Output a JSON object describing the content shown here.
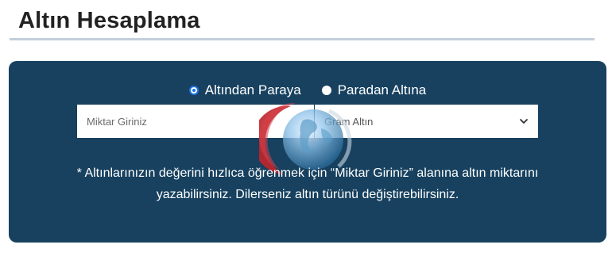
{
  "page": {
    "title": "Altın Hesaplama"
  },
  "calculator": {
    "mode_options": [
      {
        "label": "Altından Paraya",
        "selected": true
      },
      {
        "label": "Paradan Altına",
        "selected": false
      }
    ],
    "amount_input": {
      "placeholder": "Miktar Giriniz",
      "value": ""
    },
    "gold_type_select": {
      "selected": "Gram Altın"
    },
    "info_line_1": "* Altınlarınızın değerini hızlıca öğrenmek için “Miktar Giriniz” alanına altın miktarını",
    "info_line_2": "yazabilirsiniz. Dilerseniz altın türünü değiştirebilirsiniz."
  },
  "colors": {
    "panel_background": "#17415f",
    "title_rule": "#c3d0da",
    "radio_accent": "#1a73e8",
    "watermark_red": "#c0262c"
  },
  "icons": {
    "select_arrow": "chevron-down-icon",
    "watermark": "globe-logo-icon"
  }
}
